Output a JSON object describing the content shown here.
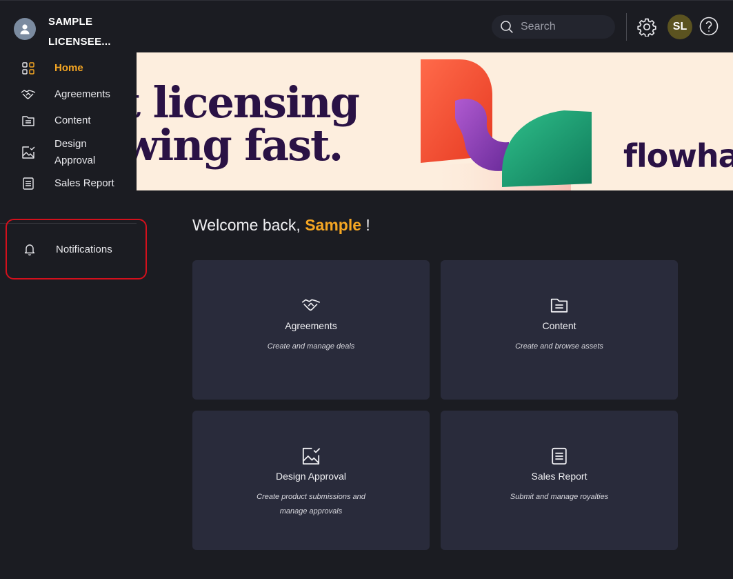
{
  "account": {
    "name": "SAMPLE LICENSEE..."
  },
  "sidebar": {
    "items": [
      {
        "label": "Home",
        "icon": "grid-icon",
        "active": true
      },
      {
        "label": "Agreements",
        "icon": "handshake-icon"
      },
      {
        "label": "Content",
        "icon": "folder-icon"
      },
      {
        "label": "Design Approval",
        "icon": "image-check-icon"
      },
      {
        "label": "Sales Report",
        "icon": "document-icon"
      }
    ],
    "notifications": {
      "label": "Notifications",
      "icon": "bell-icon"
    }
  },
  "topbar": {
    "search_placeholder": "Search",
    "user_initials": "SL"
  },
  "banner": {
    "headline_line1": "et licensing",
    "headline_line2": "owing fast.",
    "brand": "flowhaven"
  },
  "welcome": {
    "prefix": "Welcome back,",
    "name": "Sample",
    "suffix": "!"
  },
  "cards": [
    {
      "title": "Agreements",
      "subtitle": "Create and manage deals",
      "icon": "handshake-icon"
    },
    {
      "title": "Content",
      "subtitle": "Create and browse assets",
      "icon": "folder-icon"
    },
    {
      "title": "Design Approval",
      "subtitle": "Create product submissions and manage approvals",
      "icon": "image-check-icon"
    },
    {
      "title": "Sales Report",
      "subtitle": "Submit and manage royalties",
      "icon": "document-icon"
    }
  ],
  "colors": {
    "accent": "#f5a623",
    "background": "#1b1c22",
    "card": "#292b3b",
    "highlight_border": "#d4101c",
    "banner_bg": "#fdeede",
    "banner_text": "#2a1245"
  }
}
